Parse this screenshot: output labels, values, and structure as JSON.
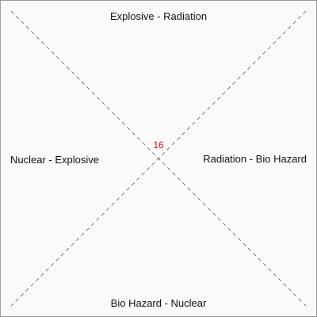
{
  "zones": {
    "top": "Explosive - Radiation",
    "left": "Nuclear - Explosive",
    "right": "Radiation - Bio Hazard",
    "bottom": "Bio Hazard - Nuclear"
  },
  "center_value": "16",
  "colors": {
    "background": "#fafafa",
    "border": "#9a9a9a",
    "diagonal_line": "#7a7a7a",
    "center_value": "#dd1111",
    "label_text": "#111111"
  }
}
